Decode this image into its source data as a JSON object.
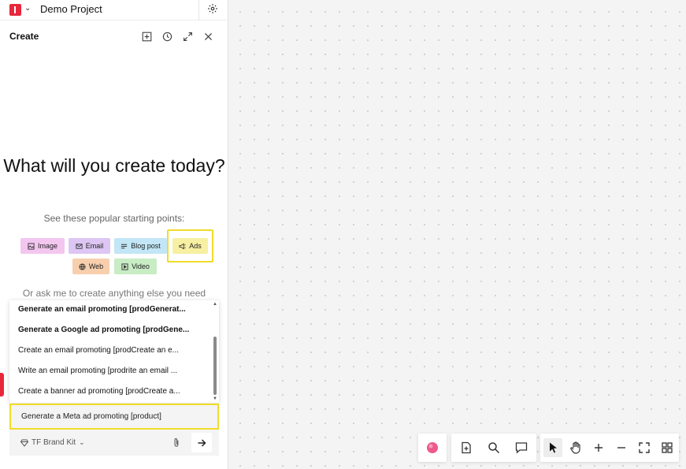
{
  "project": {
    "name": "Demo Project"
  },
  "panel": {
    "title": "Create",
    "headline": "What will you create today?",
    "subtitle": "See these popular starting points:",
    "ask_prompt": "Or ask me to create anything else you need"
  },
  "chips": [
    {
      "label": "Image",
      "color": "#f3c6f0"
    },
    {
      "label": "Email",
      "color": "#ddc6f3"
    },
    {
      "label": "Blog post",
      "color": "#c2e6f5"
    },
    {
      "label": "Ads",
      "color": "#f7efa2"
    },
    {
      "label": "Web",
      "color": "#f8cfad"
    },
    {
      "label": "Video",
      "color": "#c8ecc4"
    }
  ],
  "suggestions": [
    "Generate an email promoting [prodGenerat...",
    "Generate a Google ad promoting [prodGene...",
    "Create an email promoting [prodCreate an e...",
    "Write an email promoting [prodrite an email ...",
    "Create a banner ad promoting [prodCreate a..."
  ],
  "input": {
    "value": "Generate a Meta ad promoting [product]"
  },
  "brand_kit": {
    "label": "TF Brand Kit"
  },
  "colors": {
    "accent": "#e8273b",
    "highlight": "#f1dc2a"
  }
}
